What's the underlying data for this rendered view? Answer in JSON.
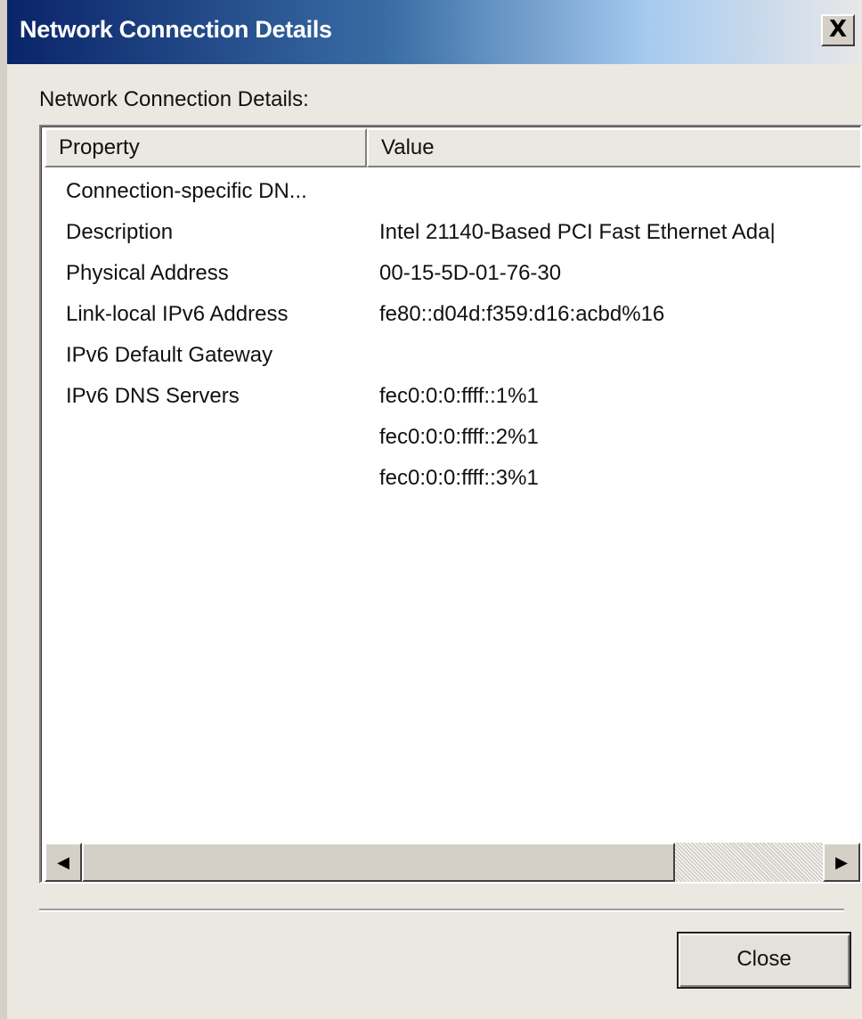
{
  "window": {
    "title": "Network Connection Details",
    "close_glyph": "X"
  },
  "dialog": {
    "section_label": "Network Connection Details:"
  },
  "table": {
    "columns": [
      "Property",
      "Value"
    ],
    "rows": [
      {
        "property": "Connection-specific DN...",
        "value": ""
      },
      {
        "property": "Description",
        "value": "Intel 21140-Based PCI Fast Ethernet Ada|"
      },
      {
        "property": "Physical Address",
        "value": "00-15-5D-01-76-30"
      },
      {
        "property": "Link-local IPv6 Address",
        "value": "fe80::d04d:f359:d16:acbd%16"
      },
      {
        "property": "IPv6 Default Gateway",
        "value": ""
      },
      {
        "property": "IPv6 DNS Servers",
        "value": "fec0:0:0:ffff::1%1"
      },
      {
        "property": "",
        "value": "fec0:0:0:ffff::2%1"
      },
      {
        "property": "",
        "value": "fec0:0:0:ffff::3%1"
      }
    ]
  },
  "scrollbar": {
    "left_glyph": "◀",
    "right_glyph": "▶"
  },
  "footer": {
    "close_label": "Close"
  },
  "colors": {
    "title_gradient_start": "#0a246a",
    "title_gradient_end": "#e8e8e8",
    "dialog_background": "#ebe8e2",
    "list_background": "#ffffff"
  }
}
